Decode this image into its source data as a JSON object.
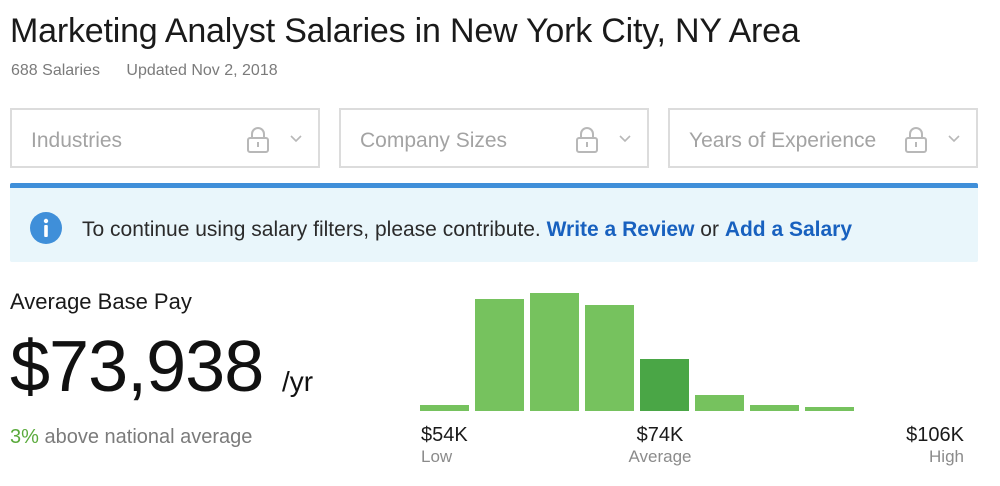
{
  "header": {
    "title": "Marketing Analyst Salaries in New York City, NY Area",
    "count": "688 Salaries",
    "updated": "Updated Nov 2, 2018"
  },
  "filters": [
    {
      "label": "Industries",
      "locked": true
    },
    {
      "label": "Company Sizes",
      "locked": true
    },
    {
      "label": "Years of Experience",
      "locked": true
    }
  ],
  "notice": {
    "text": "To continue using salary filters, please contribute.",
    "link1": "Write a Review",
    "or": "or",
    "link2": "Add a Salary"
  },
  "pay": {
    "label": "Average Base Pay",
    "amount": "$73,938",
    "unit": "/yr",
    "comparison_pct": "3%",
    "comparison_text": "above national average"
  },
  "axis": {
    "low_value": "$54K",
    "low_label": "Low",
    "avg_value": "$74K",
    "avg_label": "Average",
    "high_value": "$106K",
    "high_label": "High"
  },
  "colors": {
    "bar": "#76c25e",
    "bar_highlight": "#4aa646",
    "accent_green": "#5aaa3c",
    "link_blue": "#1861bf",
    "notice_bg": "#e9f6fb",
    "notice_border": "#3f8fd9",
    "info_icon": "#3f8fd9"
  },
  "chart_data": {
    "type": "bar",
    "title": "",
    "xlabel": "",
    "ylabel": "",
    "x_range": [
      "$54K",
      "$106K"
    ],
    "values": [
      6,
      112,
      118,
      106,
      52,
      16,
      6,
      4
    ],
    "highlight_index": 4
  }
}
